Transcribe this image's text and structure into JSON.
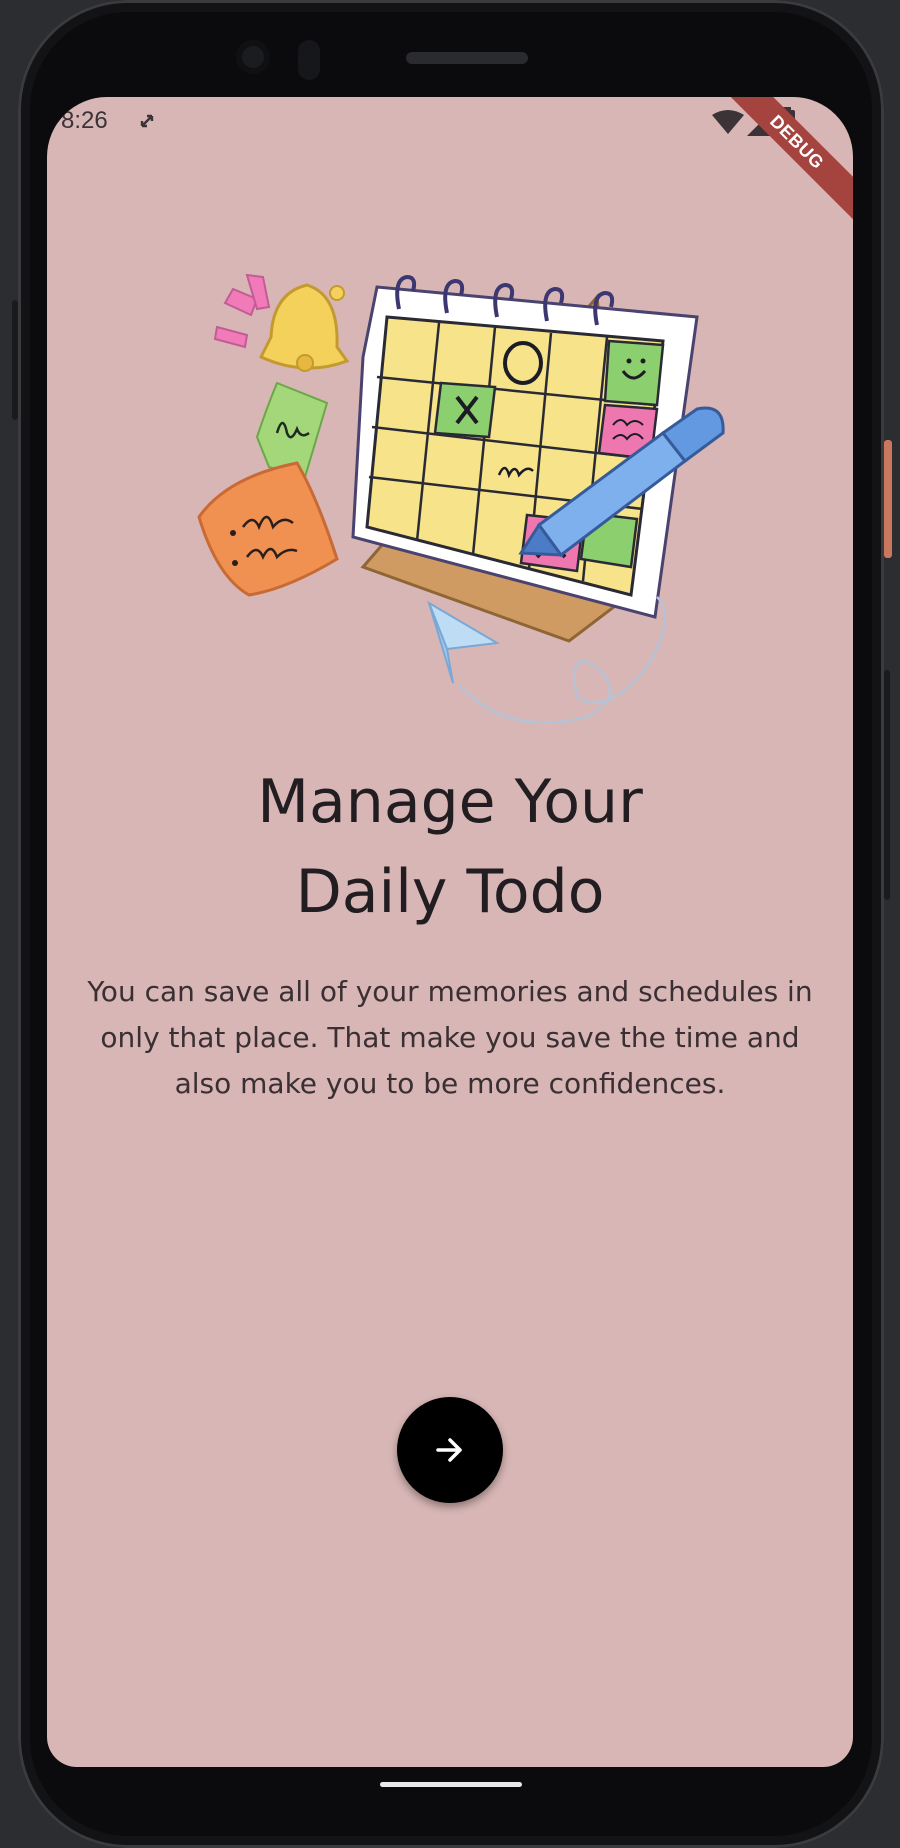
{
  "status_bar": {
    "time": "8:26",
    "icons": [
      "rotate-icon",
      "wifi-icon",
      "signal-icon",
      "battery-icon"
    ]
  },
  "debug_banner": {
    "label": "DEBUG"
  },
  "onboarding": {
    "title_line1": "Manage Your",
    "title_line2": "Daily Todo",
    "description": "You can save all of your memories and schedules in only that place. That make you save the time and also make you to be more confidences.",
    "illustration": "calendar-illustration",
    "next_button_icon": "arrow-right-icon"
  },
  "colors": {
    "screen_background": "#d7b6b5",
    "title_text": "#211d21",
    "button": "#000000",
    "debug_banner": "#a5433f"
  }
}
